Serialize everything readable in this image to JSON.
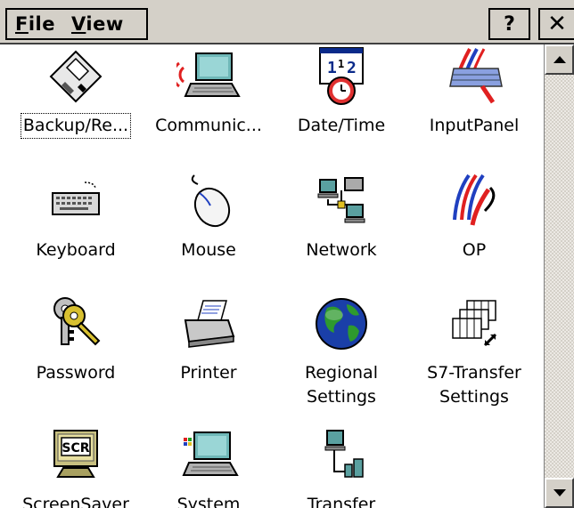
{
  "menubar": {
    "file_prefix": "F",
    "file_rest": "ile",
    "view_prefix": "V",
    "view_rest": "iew",
    "help_label": "?",
    "close_label": "✕"
  },
  "items": [
    {
      "label": "Backup/Re...",
      "icon": "floppy-disk-icon"
    },
    {
      "label": "Communic...",
      "icon": "communication-laptop-icon"
    },
    {
      "label": "Date/Time",
      "icon": "calendar-clock-icon"
    },
    {
      "label": "InputPanel",
      "icon": "keyboard-pen-icon"
    },
    {
      "label": "Keyboard",
      "icon": "keyboard-icon"
    },
    {
      "label": "Mouse",
      "icon": "mouse-icon"
    },
    {
      "label": "Network",
      "icon": "network-icon"
    },
    {
      "label": "OP",
      "icon": "op-logo-icon"
    },
    {
      "label": "Password",
      "icon": "keys-icon"
    },
    {
      "label": "Printer",
      "icon": "printer-icon"
    },
    {
      "label": "Regional\nSettings",
      "icon": "globe-icon"
    },
    {
      "label": "S7-Transfer\nSettings",
      "icon": "s7-transfer-icon"
    },
    {
      "label": "ScreenSaver",
      "icon": "screensaver-monitor-icon"
    },
    {
      "label": "System",
      "icon": "system-laptop-icon"
    },
    {
      "label": "Transfer",
      "icon": "transfer-devices-icon"
    }
  ],
  "screensaver_icon_text": "SCR",
  "colors": {
    "menubar_bg": "#d4d0c8",
    "content_bg": "#ffffff",
    "globe_blue": "#1a3fa8",
    "globe_green": "#2e9a2e",
    "key_yellow": "#d8c030"
  }
}
